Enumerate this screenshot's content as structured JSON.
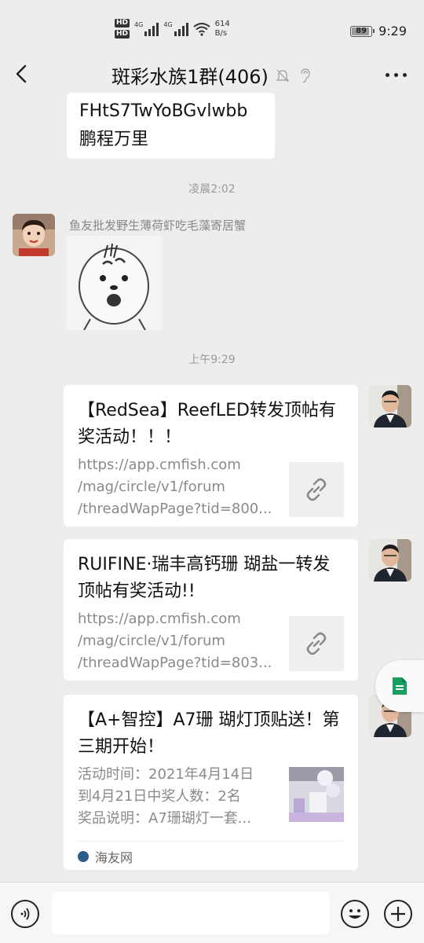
{
  "status_bar": {
    "hd1": "HD",
    "hd2": "HD",
    "net1": "4G",
    "net2": "4G",
    "speed_value": "614",
    "speed_unit": "B/s",
    "battery": "89",
    "time": "9:29"
  },
  "nav": {
    "title": "斑彩水族1群(406)",
    "icons": [
      "back-icon",
      "mute-bell-icon",
      "ear-icon",
      "more-icon"
    ]
  },
  "messages": {
    "top_bubble_lines": [
      "FHtS7TwYoBGvlwbb",
      "鹏程万里"
    ],
    "timestamp1": "凌晨2:02",
    "sender1_name": "鱼友批发野生薄荷虾吃毛藻寄居蟹",
    "timestamp2": "上午9:29",
    "cards": [
      {
        "title": "【RedSea】ReefLED转发顶帖有奖活动！！！",
        "desc": [
          "https://app.cmfish.com",
          "/mag/circle/v1/forum",
          "/threadWapPage?tid=800..."
        ],
        "thumb": "link-icon"
      },
      {
        "title": "RUIFINE·瑞丰高钙珊 瑚盐一转发顶帖有奖活动!!",
        "desc": [
          "https://app.cmfish.com",
          "/mag/circle/v1/forum",
          "/threadWapPage?tid=803..."
        ],
        "thumb": "link-icon"
      },
      {
        "title": "【A+智控】A7珊 瑚灯顶贴送！第三期开始！",
        "desc": [
          "活动时间：2021年4月14日",
          "到4月21日中奖人数：2名",
          "奖品说明：A7珊瑚灯一套..."
        ],
        "thumb": "image",
        "source": "海友网"
      }
    ]
  },
  "input": {
    "placeholder": ""
  },
  "colors": {
    "background": "#ededed",
    "bubble": "#ffffff",
    "secondary_text": "#8a8a8a"
  }
}
